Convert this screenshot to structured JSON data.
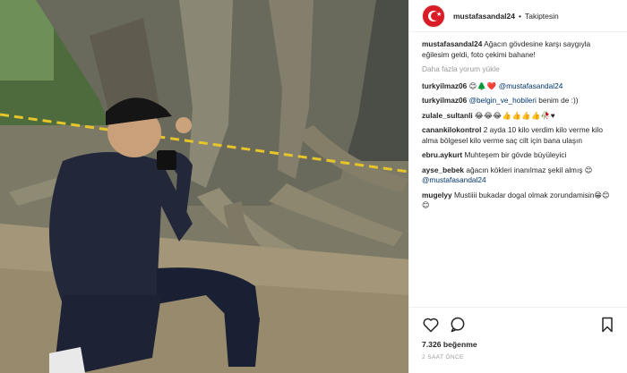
{
  "header": {
    "username": "mustafasandal24",
    "separator": "•",
    "follow_status": "Takiptesin"
  },
  "caption": {
    "username": "mustafasandal24",
    "text": "Ağacın gövdesine karşı saygıyla eğilesim geldi, foto çekimi bahane!"
  },
  "load_more": "Daha fazla yorum yükle",
  "comments": [
    {
      "user": "turkyilmaz06",
      "emoji": "😊🌲❤️",
      "mention": "@mustafasandal24",
      "text": ""
    },
    {
      "user": "turkyilmaz06",
      "emoji": "",
      "mention": "@belgin_ve_hobileri",
      "text": "benim de :))"
    },
    {
      "user": "zulale_sultanli",
      "emoji": "😂😂😂👍👍👍👍🥀♥",
      "mention": "",
      "text": ""
    },
    {
      "user": "canankilokontrol",
      "emoji": "",
      "mention": "",
      "text": "2 ayda 10 kilo verdim kilo verme kilo alma bölgesel kilo verme saç cilt için bana ulaşın"
    },
    {
      "user": "ebru.aykurt",
      "emoji": "",
      "mention": "",
      "text": "Muhteşem bir gövde büyüleyici"
    },
    {
      "user": "ayse_bebek",
      "emoji": "",
      "mention": "@mustafasandal24",
      "text": "ağacın kökleri inanılmaz şekil almış 😊"
    },
    {
      "user": "mugelyy",
      "emoji": "",
      "mention": "",
      "text": "Mustiiii bukadar dogal olmak zorundamisin😁😊😊"
    }
  ],
  "likes": "7.326 beğenme",
  "time_ago": "2 SAAT ÖNCE",
  "icons": {
    "like": "heart-icon",
    "comment": "comment-icon",
    "save": "bookmark-icon",
    "verified": "check-icon"
  }
}
